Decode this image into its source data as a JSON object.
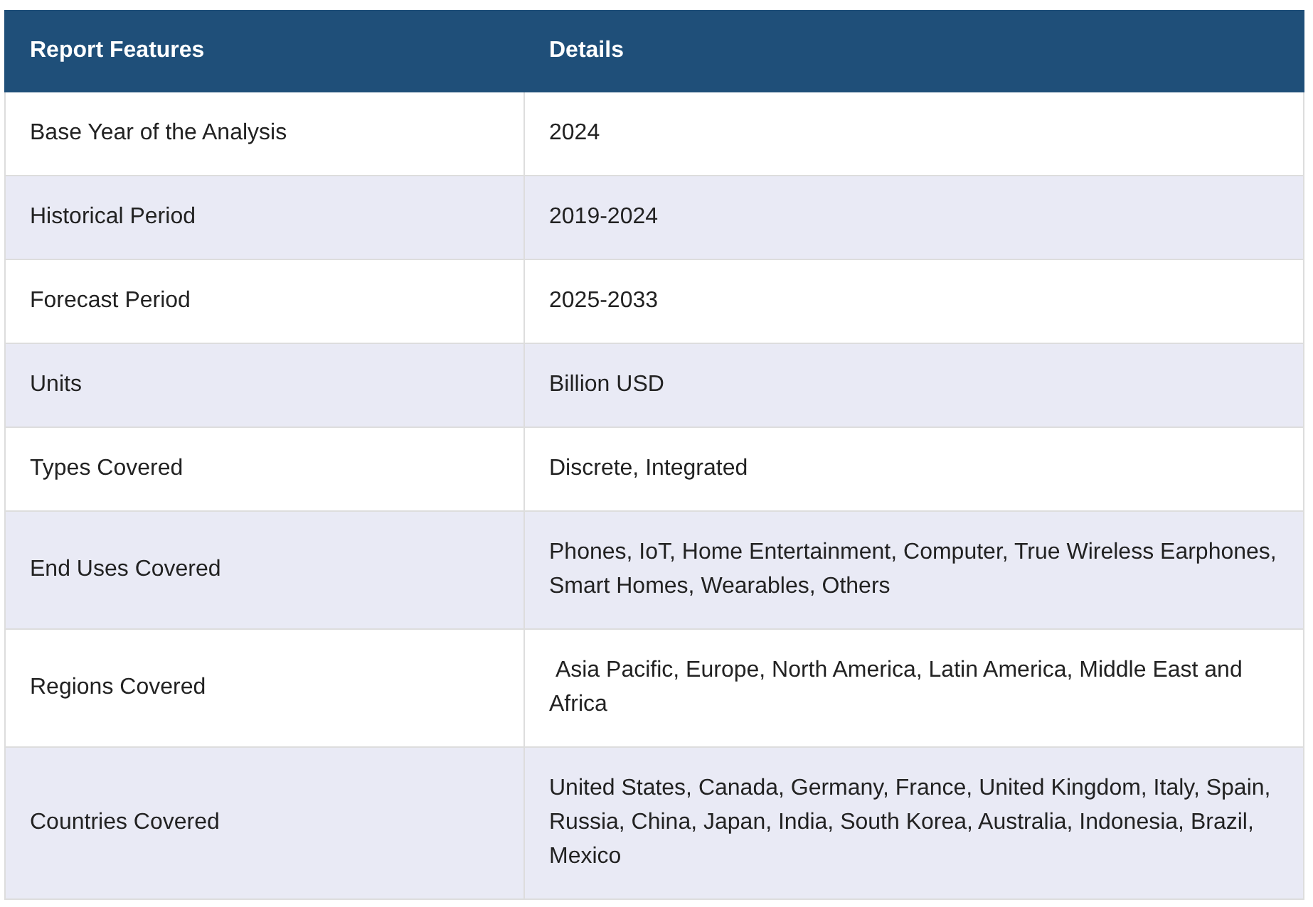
{
  "table": {
    "columns": [
      "Report Features",
      "Details"
    ],
    "rows": [
      {
        "feature": "Base Year of the Analysis",
        "details": "2024"
      },
      {
        "feature": "Historical Period",
        "details": "2019-2024"
      },
      {
        "feature": "Forecast Period",
        "details": "2025-2033"
      },
      {
        "feature": "Units",
        "details": "Billion USD"
      },
      {
        "feature": "Types Covered",
        "details": "Discrete, Integrated"
      },
      {
        "feature": "End Uses Covered",
        "details": "Phones, IoT, Home Entertainment, Computer, True Wireless Earphones, Smart Homes, Wearables, Others"
      },
      {
        "feature": "Regions Covered",
        "details": " Asia Pacific, Europe, North America, Latin America, Middle East and Africa"
      },
      {
        "feature": "Countries Covered",
        "details": "United States, Canada, Germany, France, United Kingdom, Italy, Spain, Russia, China, Japan, India, South Korea, Australia, Indonesia, Brazil, Mexico"
      }
    ]
  }
}
